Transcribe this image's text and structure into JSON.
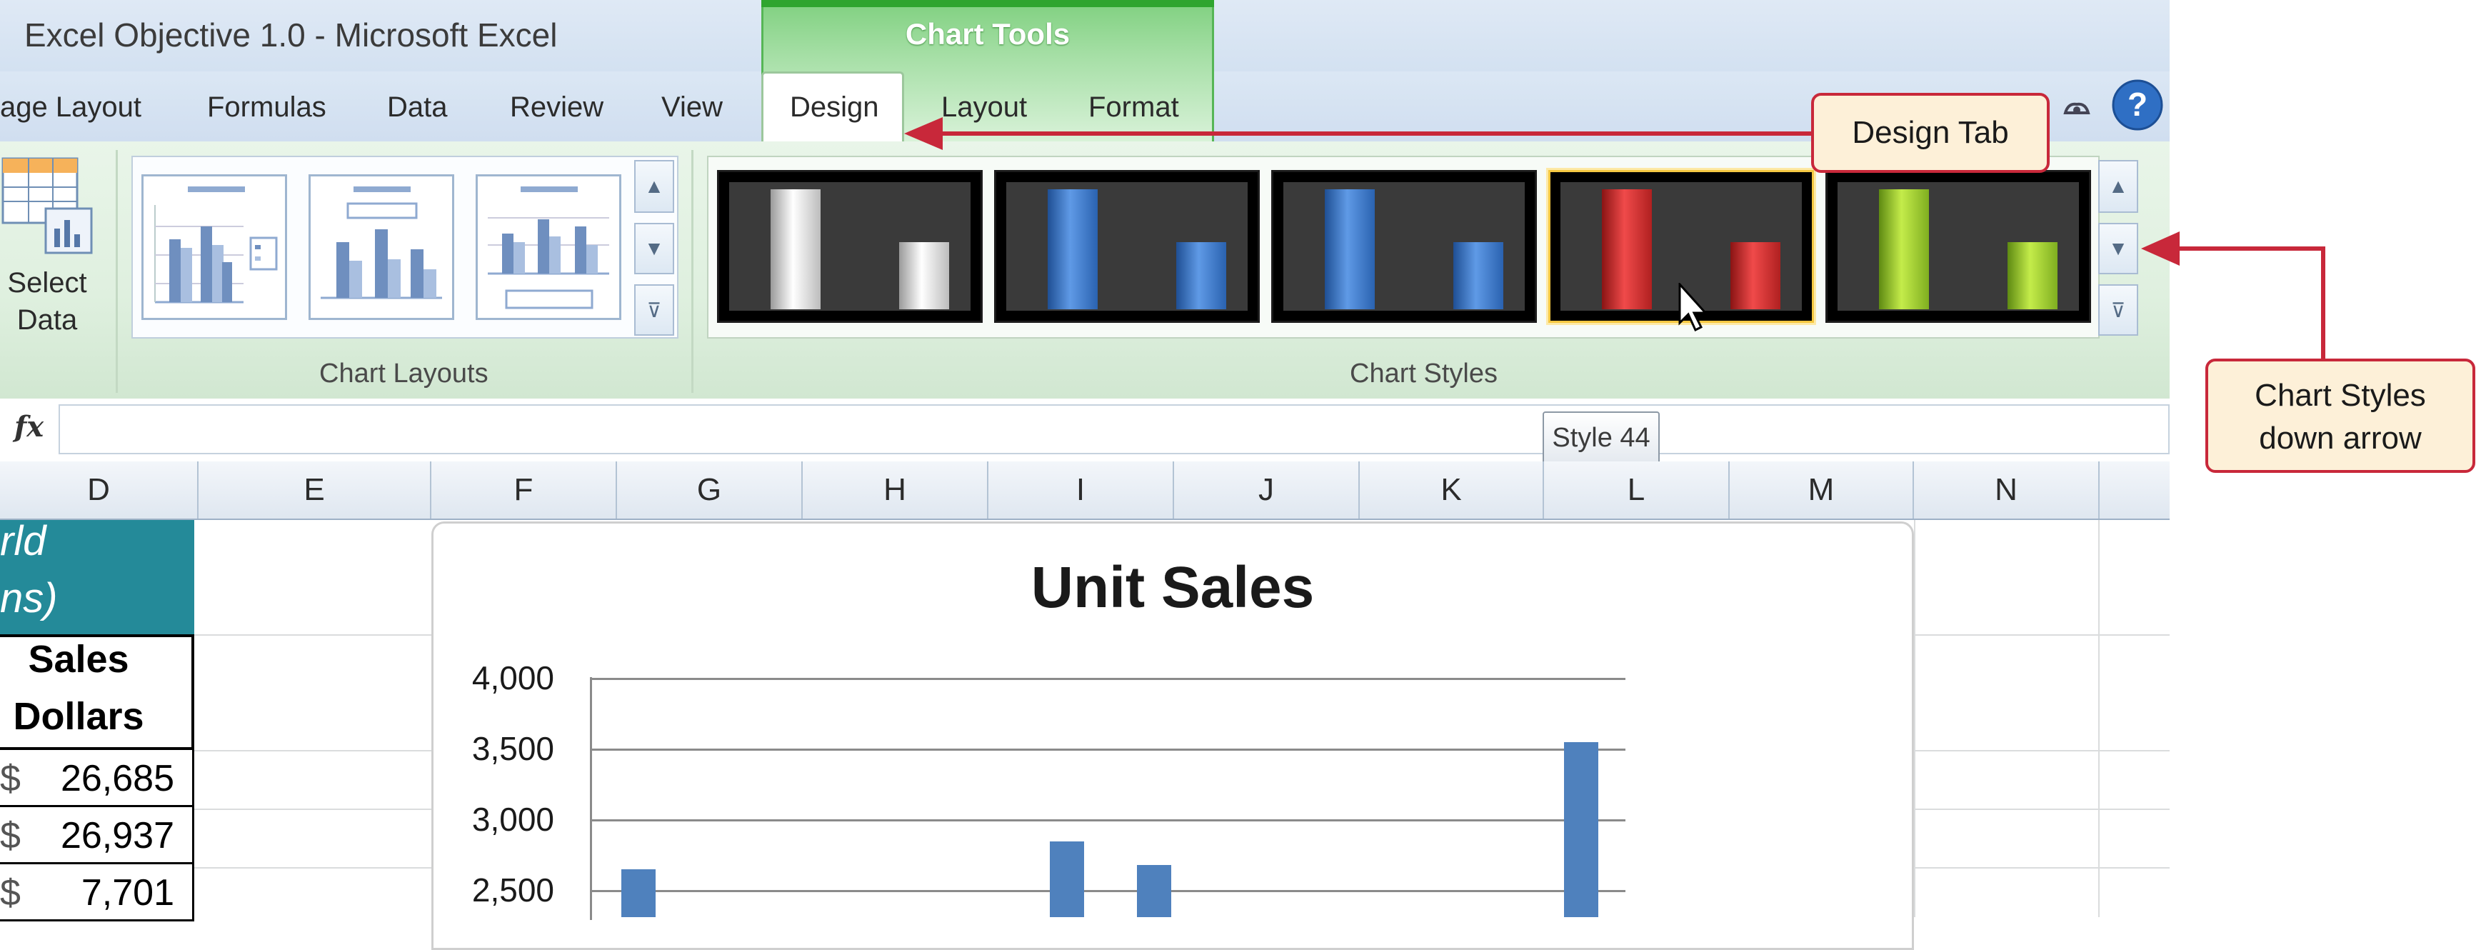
{
  "window": {
    "title": "Excel Objective 1.0  -  Microsoft Excel"
  },
  "contextual_tab_group": {
    "label": "Chart Tools",
    "color": "#7fd07f"
  },
  "tabs": [
    {
      "label": "age Layout"
    },
    {
      "label": "Formulas"
    },
    {
      "label": "Data"
    },
    {
      "label": "Review"
    },
    {
      "label": "View"
    },
    {
      "label": "Design",
      "selected": true
    },
    {
      "label": "Layout"
    },
    {
      "label": "Format"
    }
  ],
  "ribbon": {
    "data_group": {
      "select_data_label_line1": "Select",
      "select_data_label_line2": "Data"
    },
    "chart_layouts": {
      "label": "Chart Layouts",
      "thumbnail_count": 3
    },
    "chart_styles": {
      "label": "Chart Styles",
      "styles": [
        {
          "color": "#e8e8e8"
        },
        {
          "color": "#3a75c4"
        },
        {
          "color": "#3a75c4"
        },
        {
          "color": "#cc2a2a",
          "hovered": true
        },
        {
          "color": "#8fbf2a"
        }
      ]
    }
  },
  "tooltip": {
    "text": "Style 44"
  },
  "callouts": {
    "design_tab": "Design Tab",
    "chart_styles_line1": "Chart Styles",
    "chart_styles_line2": "down arrow"
  },
  "formula_bar": {
    "fx_label": "fx",
    "value": ""
  },
  "columns": [
    "D",
    "E",
    "F",
    "G",
    "H",
    "I",
    "J",
    "K",
    "L",
    "M",
    "N"
  ],
  "sheet": {
    "teal_header_line1": "rld",
    "teal_header_line2": "ns)",
    "sales_header_line1": "Sales",
    "sales_header_line2": "Dollars",
    "values": [
      "26,685",
      "26,937",
      "7,701"
    ],
    "dollar_sign": "$"
  },
  "chart_data": {
    "type": "bar",
    "title": "Unit Sales",
    "ylim": [
      0,
      4000
    ],
    "yticks": [
      "4,000",
      "3,500",
      "3,000",
      "2,500"
    ],
    "values": [
      2650,
      2850,
      2680,
      3550
    ],
    "bar_color": "#4f81bd"
  }
}
